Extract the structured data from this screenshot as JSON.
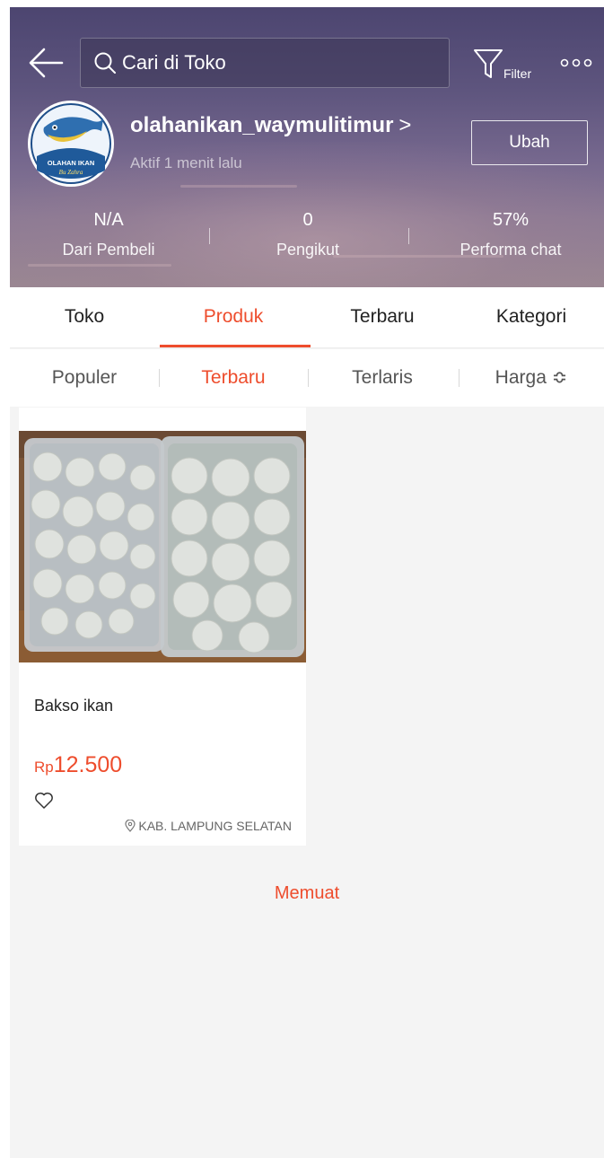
{
  "header": {
    "search_placeholder": "Cari di Toko",
    "filter_label": "Filter",
    "shop": {
      "name": "olahanikan_waymulitimur",
      "name_chevron": ">",
      "active_status": "Aktif 1 menit lalu",
      "edit_button": "Ubah",
      "logo_text_line1": "OLAHAN IKAN",
      "logo_text_line2": "Bu Zahra"
    },
    "stats": [
      {
        "value": "N/A",
        "label": "Dari Pembeli"
      },
      {
        "value": "0",
        "label": "Pengikut"
      },
      {
        "value": "57%",
        "label": "Performa chat"
      }
    ]
  },
  "tabs": [
    {
      "label": "Toko",
      "active": false
    },
    {
      "label": "Produk",
      "active": true
    },
    {
      "label": "Terbaru",
      "active": false
    },
    {
      "label": "Kategori",
      "active": false
    }
  ],
  "sort": [
    {
      "label": "Populer",
      "active": false
    },
    {
      "label": "Terbaru",
      "active": true
    },
    {
      "label": "Terlaris",
      "active": false
    },
    {
      "label": "Harga ≎",
      "active": false
    }
  ],
  "products": [
    {
      "name": "Bakso ikan",
      "price_currency": "Rp",
      "price_amount": "12.500",
      "location": "KAB. LAMPUNG SELATAN"
    }
  ],
  "loading_text": "Memuat",
  "colors": {
    "accent": "#ee4d2d",
    "header_top": "#4c4570",
    "header_bottom": "#9a8792"
  },
  "icons": [
    "back-arrow-icon",
    "search-icon",
    "filter-icon",
    "more-icon",
    "heart-icon",
    "location-pin-icon"
  ]
}
